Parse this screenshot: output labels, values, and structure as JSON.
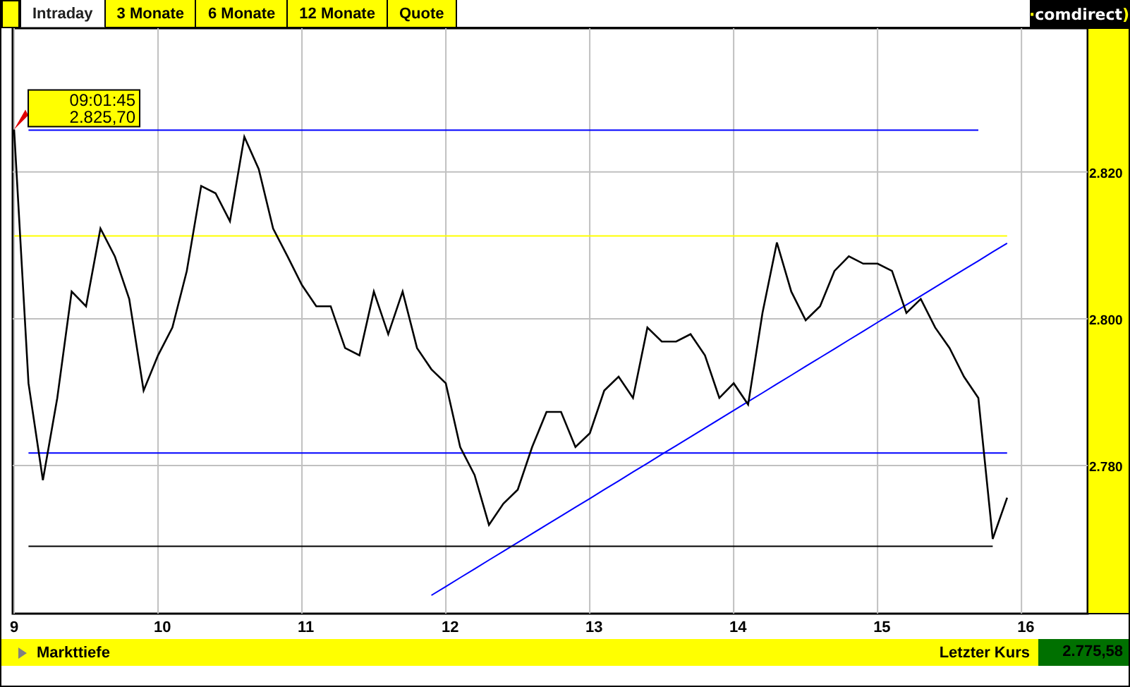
{
  "tabs": [
    {
      "label": "Intraday",
      "selected": true
    },
    {
      "label": "3 Monate",
      "selected": false
    },
    {
      "label": "6 Monate",
      "selected": false
    },
    {
      "label": "12 Monate",
      "selected": false
    },
    {
      "label": "Quote",
      "selected": false
    }
  ],
  "logo": {
    "prefix": "·",
    "name": "comdirect",
    "suffix": ")"
  },
  "chart": {
    "tooltip": {
      "time": "09:01:45",
      "price": "2.825,70"
    },
    "chart_data": {
      "type": "line",
      "grid": true,
      "xlim": [
        8.99,
        16.46
      ],
      "ylim": [
        2759.8,
        2839.6
      ],
      "xticks": [
        9,
        10,
        11,
        12,
        13,
        14,
        15,
        16
      ],
      "yticks": [
        {
          "value": 2780,
          "label": "2.780"
        },
        {
          "value": 2800,
          "label": "2.800"
        },
        {
          "value": 2820,
          "label": "2.820"
        }
      ],
      "x": [
        9.0,
        9.1,
        9.2,
        9.3,
        9.4,
        9.5,
        9.6,
        9.7,
        9.8,
        9.9,
        10.0,
        10.1,
        10.2,
        10.3,
        10.4,
        10.5,
        10.6,
        10.7,
        10.8,
        10.9,
        11.0,
        11.1,
        11.2,
        11.3,
        11.4,
        11.5,
        11.6,
        11.7,
        11.8,
        11.9,
        12.0,
        12.1,
        12.2,
        12.3,
        12.4,
        12.5,
        12.6,
        12.7,
        12.8,
        12.9,
        13.0,
        13.1,
        13.2,
        13.3,
        13.4,
        13.5,
        13.6,
        13.7,
        13.8,
        13.9,
        14.0,
        14.1,
        14.2,
        14.3,
        14.4,
        14.5,
        14.6,
        14.7,
        14.8,
        14.9,
        15.0,
        15.1,
        15.2,
        15.3,
        15.4,
        15.5,
        15.6,
        15.7,
        15.8,
        15.9
      ],
      "series": [
        {
          "color": "#000000",
          "values": [
            2825.8,
            2791.2,
            2778.0,
            2789.2,
            2803.7,
            2801.7,
            2812.3,
            2808.5,
            2802.7,
            2790.2,
            2795.0,
            2798.8,
            2806.5,
            2818.1,
            2817.1,
            2813.3,
            2824.8,
            2820.4,
            2812.3,
            2808.5,
            2804.6,
            2801.7,
            2801.7,
            2796.0,
            2795.0,
            2803.7,
            2797.9,
            2803.7,
            2796.0,
            2793.1,
            2791.2,
            2782.5,
            2778.7,
            2771.9,
            2774.8,
            2776.7,
            2782.5,
            2787.3,
            2787.3,
            2782.5,
            2784.4,
            2790.2,
            2792.1,
            2789.2,
            2798.8,
            2796.9,
            2796.9,
            2797.9,
            2795.0,
            2789.2,
            2791.2,
            2788.3,
            2800.8,
            2810.4,
            2803.7,
            2799.8,
            2801.7,
            2806.5,
            2808.5,
            2807.5,
            2807.5,
            2806.5,
            2800.8,
            2802.7,
            2798.8,
            2796.0,
            2792.1,
            2789.2,
            2770.0,
            2775.6
          ]
        },
        {
          "color": "#0000ff",
          "values": [
            null,
            2825.7,
            2825.7,
            2825.7,
            2825.7,
            2825.7,
            2825.7,
            2825.7,
            2825.7,
            2825.7,
            2825.7,
            2825.7,
            2825.7,
            2825.7,
            2825.7,
            2825.7,
            2825.7,
            2825.7,
            2825.7,
            2825.7,
            2825.7,
            2825.7,
            2825.7,
            2825.7,
            2825.7,
            2825.7,
            2825.7,
            2825.7,
            2825.7,
            2825.7,
            2825.7,
            2825.7,
            2825.7,
            2825.7,
            2825.7,
            2825.7,
            2825.7,
            2825.7,
            2825.7,
            2825.7,
            2825.7,
            2825.7,
            2825.7,
            2825.7,
            2825.7,
            2825.7,
            2825.7,
            2825.7,
            2825.7,
            2825.7,
            2825.7,
            2825.7,
            2825.7,
            2825.7,
            2825.7,
            2825.7,
            2825.7,
            2825.7,
            2825.7,
            2825.7,
            2825.7,
            2825.7,
            2825.7,
            2825.7,
            2825.7,
            2825.7,
            2825.7,
            2825.7,
            null,
            null
          ]
        },
        {
          "color": "#ffff00",
          "values": [
            2811.3,
            2811.3,
            2811.3,
            2811.3,
            2811.3,
            2811.3,
            2811.3,
            2811.3,
            2811.3,
            2811.3,
            2811.3,
            2811.3,
            2811.3,
            2811.3,
            2811.3,
            2811.3,
            2811.3,
            2811.3,
            2811.3,
            2811.3,
            2811.3,
            2811.3,
            2811.3,
            2811.3,
            2811.3,
            2811.3,
            2811.3,
            2811.3,
            2811.3,
            2811.3,
            2811.3,
            2811.3,
            2811.3,
            2811.3,
            2811.3,
            2811.3,
            2811.3,
            2811.3,
            2811.3,
            2811.3,
            2811.3,
            2811.3,
            2811.3,
            2811.3,
            2811.3,
            2811.3,
            2811.3,
            2811.3,
            2811.3,
            2811.3,
            2811.3,
            2811.3,
            2811.3,
            2811.3,
            2811.3,
            2811.3,
            2811.3,
            2811.3,
            2811.3,
            2811.3,
            2811.3,
            2811.3,
            2811.3,
            2811.3,
            2811.3,
            2811.3,
            2811.3,
            2811.3,
            2811.3,
            2811.3
          ]
        },
        {
          "color": "#0000ff",
          "values": [
            null,
            2781.7,
            2781.7,
            2781.7,
            2781.7,
            2781.7,
            2781.7,
            2781.7,
            2781.7,
            2781.7,
            2781.7,
            2781.7,
            2781.7,
            2781.7,
            2781.7,
            2781.7,
            2781.7,
            2781.7,
            2781.7,
            2781.7,
            2781.7,
            2781.7,
            2781.7,
            2781.7,
            2781.7,
            2781.7,
            2781.7,
            2781.7,
            2781.7,
            2781.7,
            2781.7,
            2781.7,
            2781.7,
            2781.7,
            2781.7,
            2781.7,
            2781.7,
            2781.7,
            2781.7,
            2781.7,
            2781.7,
            2781.7,
            2781.7,
            2781.7,
            2781.7,
            2781.7,
            2781.7,
            2781.7,
            2781.7,
            2781.7,
            2781.7,
            2781.7,
            2781.7,
            2781.7,
            2781.7,
            2781.7,
            2781.7,
            2781.7,
            2781.7,
            2781.7,
            2781.7,
            2781.7,
            2781.7,
            2781.7,
            2781.7,
            2781.7,
            2781.7,
            2781.7,
            2781.7,
            2781.7
          ]
        },
        {
          "color": "#000000",
          "values": [
            null,
            2769.0,
            2769.0,
            2769.0,
            2769.0,
            2769.0,
            2769.0,
            2769.0,
            2769.0,
            2769.0,
            2769.0,
            2769.0,
            2769.0,
            2769.0,
            2769.0,
            2769.0,
            2769.0,
            2769.0,
            2769.0,
            2769.0,
            2769.0,
            2769.0,
            2769.0,
            2769.0,
            2769.0,
            2769.0,
            2769.0,
            2769.0,
            2769.0,
            2769.0,
            2769.0,
            2769.0,
            2769.0,
            2769.0,
            2769.0,
            2769.0,
            2769.0,
            2769.0,
            2769.0,
            2769.0,
            2769.0,
            2769.0,
            2769.0,
            2769.0,
            2769.0,
            2769.0,
            2769.0,
            2769.0,
            2769.0,
            2769.0,
            2769.0,
            2769.0,
            2769.0,
            2769.0,
            2769.0,
            2769.0,
            2769.0,
            2769.0,
            2769.0,
            2769.0,
            2769.0,
            2769.0,
            2769.0,
            2769.0,
            2769.0,
            2769.0,
            2769.0,
            2769.0,
            2769.0,
            null
          ]
        },
        {
          "color": "#0000ff",
          "values": [
            null,
            null,
            null,
            null,
            null,
            null,
            null,
            null,
            null,
            null,
            null,
            null,
            null,
            null,
            null,
            null,
            null,
            null,
            null,
            null,
            null,
            null,
            null,
            null,
            null,
            null,
            null,
            null,
            null,
            2762.3,
            2763.5,
            2764.7,
            2765.9,
            2767.1,
            2768.3,
            2769.5,
            2770.7,
            2771.9,
            2773.1,
            2774.3,
            2775.5,
            2776.7,
            2777.9,
            2779.1,
            2780.3,
            2781.5,
            2782.7,
            2783.9,
            2785.1,
            2786.3,
            2787.5,
            2788.7,
            2789.9,
            2791.1,
            2792.3,
            2793.5,
            2794.7,
            2795.9,
            2797.1,
            2798.3,
            2799.5,
            2800.7,
            2801.9,
            2803.1,
            2804.3,
            2805.5,
            2806.7,
            2807.9,
            2809.1,
            2810.3
          ]
        }
      ]
    }
  },
  "footer": {
    "link": "Markttiefe",
    "last_label": "Letzter Kurs",
    "last_value": "2.775,58"
  }
}
